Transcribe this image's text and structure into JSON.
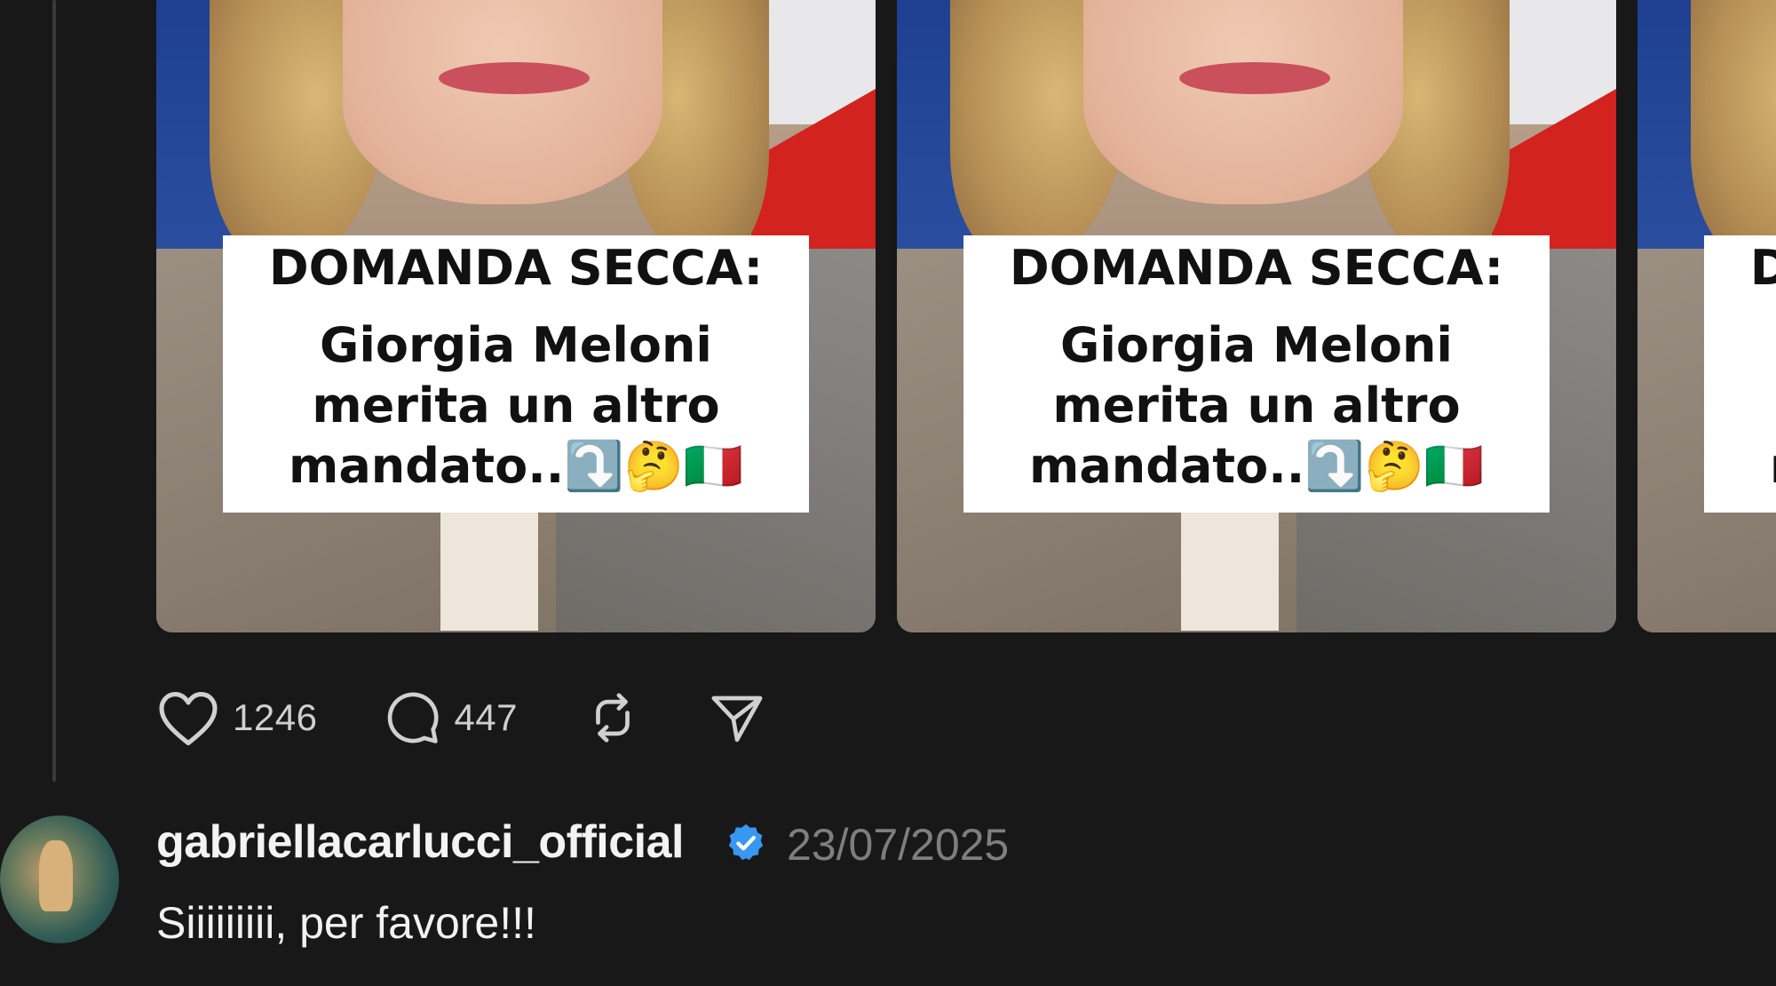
{
  "post": {
    "carousel": [
      {
        "caption_head": "DOMANDA SECCA:",
        "caption_body": "Giorgia Meloni\nmerita un altro\nmandato..⤵️🤔🇮🇹"
      },
      {
        "caption_head": "DOMANDA SECCA:",
        "caption_body": "Giorgia Meloni\nmerita un altro\nmandato..⤵️🤔🇮🇹"
      },
      {
        "caption_head": "DOMANDA SECCA:",
        "caption_body": "Giorgia Meloni\nmerita un altro\nmandato..⤵️🤔🇮🇹"
      }
    ],
    "actions": {
      "like_icon": "heart-icon",
      "like_count": "1246",
      "comment_icon": "comment-bubble-icon",
      "comment_count": "447",
      "repost_icon": "repost-icon",
      "share_icon": "send-icon"
    }
  },
  "reply": {
    "username": "gabriellacarlucci_official",
    "verified": true,
    "verified_color": "#3897f0",
    "date": "23/07/2025",
    "text": "Siiiiiiiii, per favore!!!"
  },
  "colors": {
    "background": "#181818",
    "flag_red": "#d2231f",
    "flag_blue": "#1e3f8f"
  }
}
